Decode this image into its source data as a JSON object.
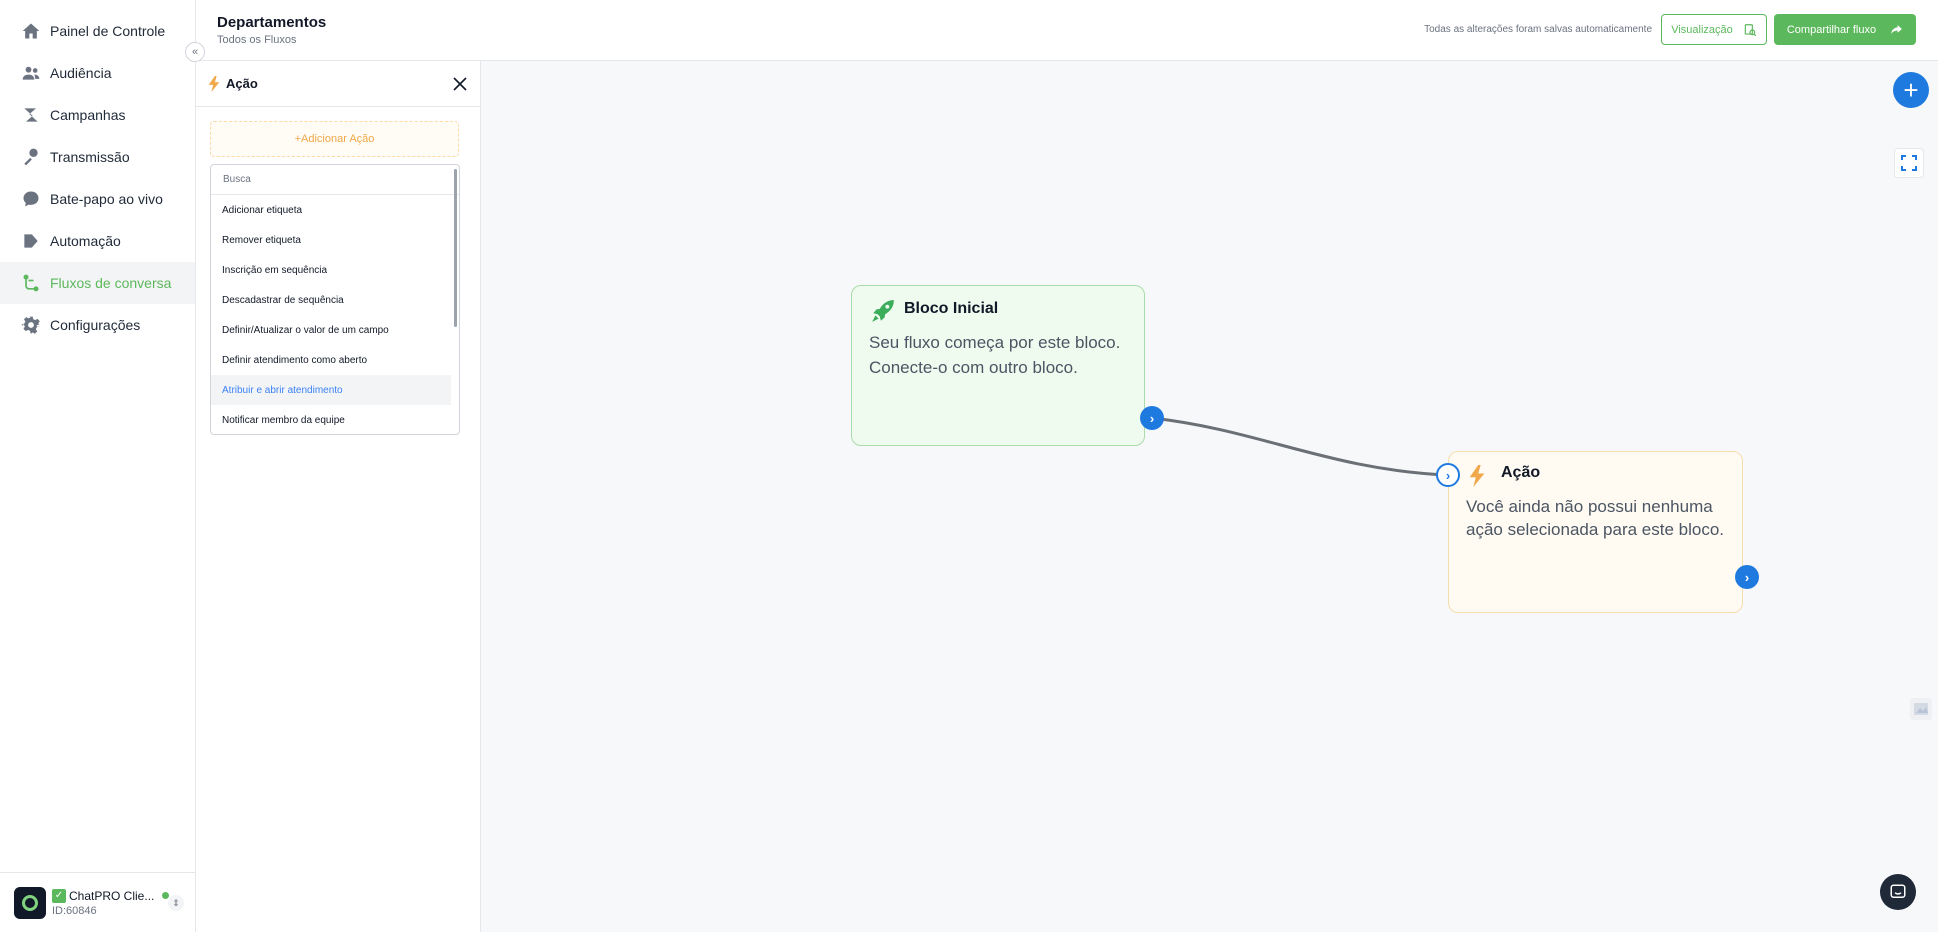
{
  "sidebar": {
    "items": [
      {
        "label": "Painel de Controle",
        "icon": "home-icon"
      },
      {
        "label": "Audiência",
        "icon": "users-icon"
      },
      {
        "label": "Campanhas",
        "icon": "campaigns-icon"
      },
      {
        "label": "Transmissão",
        "icon": "broadcast-icon"
      },
      {
        "label": "Bate-papo ao vivo",
        "icon": "chat-bubble-icon"
      },
      {
        "label": "Automação",
        "icon": "automation-icon"
      },
      {
        "label": "Fluxos de conversa",
        "icon": "flow-icon",
        "active": true
      },
      {
        "label": "Configurações",
        "icon": "gear-icon"
      }
    ],
    "account": {
      "name": "ChatPRO Clie...",
      "id": "ID:60846"
    }
  },
  "header": {
    "title": "Departamentos",
    "subtitle": "Todos os Fluxos",
    "save_status": "Todas as alterações foram salvas automaticamente",
    "preview_label": "Visualização",
    "share_label": "Compartilhar fluxo"
  },
  "panel": {
    "title": "Ação",
    "add_action_label": "+Adicionar Ação",
    "search_placeholder": "Busca",
    "options": [
      "Adicionar etiqueta",
      "Remover etiqueta",
      "Inscrição em sequência",
      "Descadastrar de sequência",
      "Definir/Atualizar o valor de um campo",
      "Definir atendimento como aberto",
      "Atribuir e abrir atendimento",
      "Notificar membro da equipe"
    ],
    "hovered_option": "Atribuir e abrir atendimento"
  },
  "canvas": {
    "start_node": {
      "title": "Bloco Inicial",
      "description": "Seu fluxo começa por este bloco. Conecte-o com outro bloco."
    },
    "action_node": {
      "title": "Ação",
      "description": "Você ainda não possui nenhuma ação selecionada para este bloco."
    }
  },
  "colors": {
    "brand_green": "#5cb85c",
    "accent_blue": "#1f7ae0",
    "action_orange": "#f0a84a"
  }
}
